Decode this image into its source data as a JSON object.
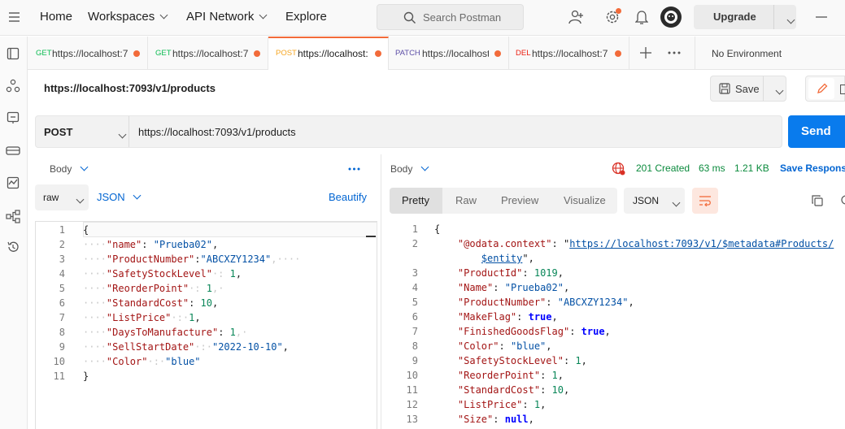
{
  "topbar": {
    "nav": [
      "Home",
      "Workspaces",
      "API Network",
      "Explore"
    ],
    "search_placeholder": "Search Postman",
    "upgrade_label": "Upgrade"
  },
  "tabs": [
    {
      "method": "GET",
      "url": "https://localhost:7",
      "method_color": "#0cbb52"
    },
    {
      "method": "GET",
      "url": "https://localhost:7",
      "method_color": "#0cbb52"
    },
    {
      "method": "POST",
      "url": "https://localhost:",
      "method_color": "#f5a623"
    },
    {
      "method": "PATCH",
      "url": "https://localhost",
      "method_color": "#5c4ea6"
    },
    {
      "method": "DEL",
      "url": "https://localhost:7",
      "method_color": "#eb2013"
    }
  ],
  "environment": "No Environment",
  "request": {
    "title": "https://localhost:7093/v1/products",
    "save_label": "Save",
    "method": "POST",
    "url": "https://localhost:7093/v1/products",
    "send_label": "Send"
  },
  "request_pane": {
    "body_label": "Body",
    "mode": "raw",
    "format": "JSON",
    "beautify_label": "Beautify",
    "line_numbers": [
      "1",
      "2",
      "3",
      "4",
      "5",
      "6",
      "7",
      "8",
      "9",
      "10",
      "11"
    ]
  },
  "response_pane": {
    "body_label": "Body",
    "status": "201 Created",
    "time": "63 ms",
    "size": "1.21 KB",
    "save_response_label": "Save Respons",
    "view_tabs": [
      "Pretty",
      "Raw",
      "Preview",
      "Visualize"
    ],
    "format": "JSON",
    "line_numbers": [
      "1",
      "2",
      "",
      "3",
      "4",
      "5",
      "6",
      "7",
      "8",
      "9",
      "10",
      "11",
      "12",
      "13"
    ]
  },
  "colors": {
    "accent": "#f26b3a",
    "send": "#097bed",
    "status_ok": "#0a8a3c"
  }
}
